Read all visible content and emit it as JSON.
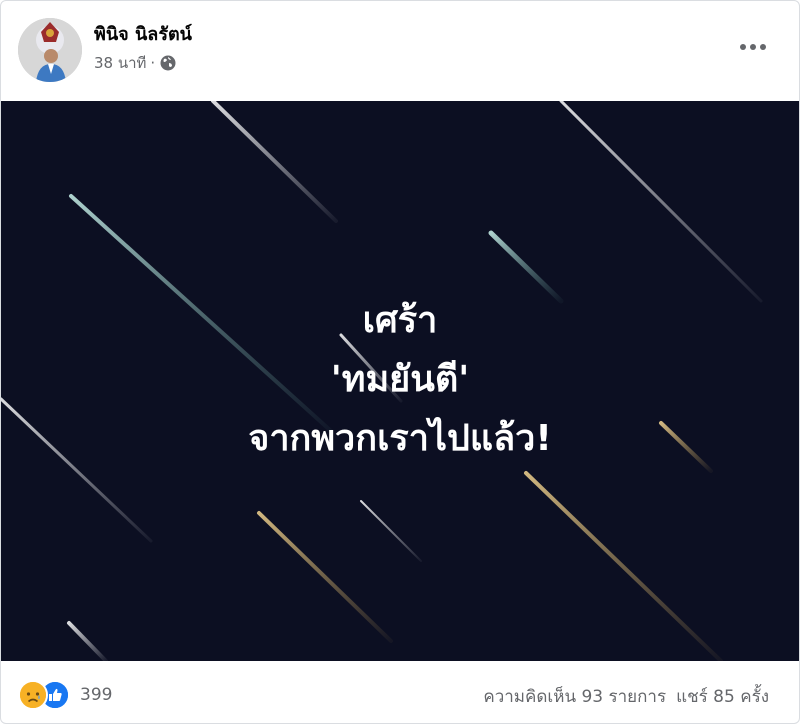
{
  "post": {
    "author": "พินิจ นิลรัตน์",
    "time": "38 นาที",
    "separator": "·",
    "privacy_icon": "globe-icon",
    "more_icon": "more-options-icon"
  },
  "image": {
    "lines": [
      "เศร้า",
      "'ทมยันตี'",
      "จากพวกเราไปแล้ว!"
    ],
    "background": "#0c0f22"
  },
  "footer": {
    "reaction_icons": [
      "sad-reaction-icon",
      "like-reaction-icon"
    ],
    "reaction_count": "399",
    "comments": "ความคิดเห็น 93 รายการ",
    "shares": "แชร์ 85 ครั้ง"
  },
  "colors": {
    "like_blue": "#1877f2",
    "sad_yellow": "#f7b125",
    "secondary_text": "#65676b"
  }
}
